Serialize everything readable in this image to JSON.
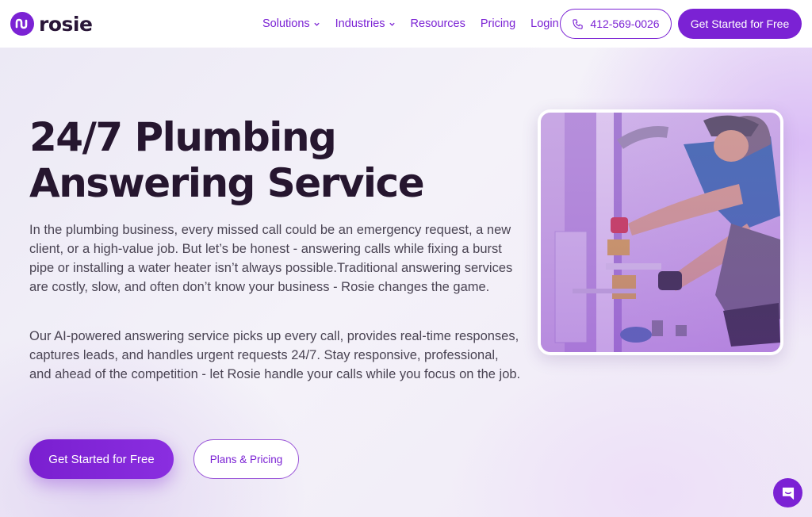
{
  "header": {
    "logo_text": "rosie",
    "nav": [
      {
        "label": "Solutions",
        "dropdown": true
      },
      {
        "label": "Industries",
        "dropdown": true
      },
      {
        "label": "Resources",
        "dropdown": false
      },
      {
        "label": "Pricing",
        "dropdown": false
      },
      {
        "label": "Login",
        "dropdown": false
      }
    ],
    "phone": "412-569-0026",
    "cta": "Get Started for Free"
  },
  "hero": {
    "title_line1": "24/7 Plumbing",
    "title_line2": "Answering Service",
    "paragraph1": "In the plumbing business, every missed call could be an emergency request, a new client, or a high-value job. But let’s be honest - answering calls while fixing a burst pipe or installing a water heater isn’t always possible.Traditional answering services are costly, slow, and often don’t know your business - Rosie changes the game.",
    "paragraph2": "Our AI-powered answering service picks up every call, provides real-time responses, captures leads, and handles urgent requests 24/7. Stay responsive, professional, and ahead of the competition - let Rosie handle your calls while you focus on the job.",
    "primary_button": "Get Started for Free",
    "secondary_button": "Plans & Pricing",
    "image_icon": "plumber-photo"
  },
  "chat": {
    "icon": "chat-icon"
  },
  "colors": {
    "brand": "#7b22d4",
    "title": "#26162f",
    "body_text": "#4a4453"
  }
}
